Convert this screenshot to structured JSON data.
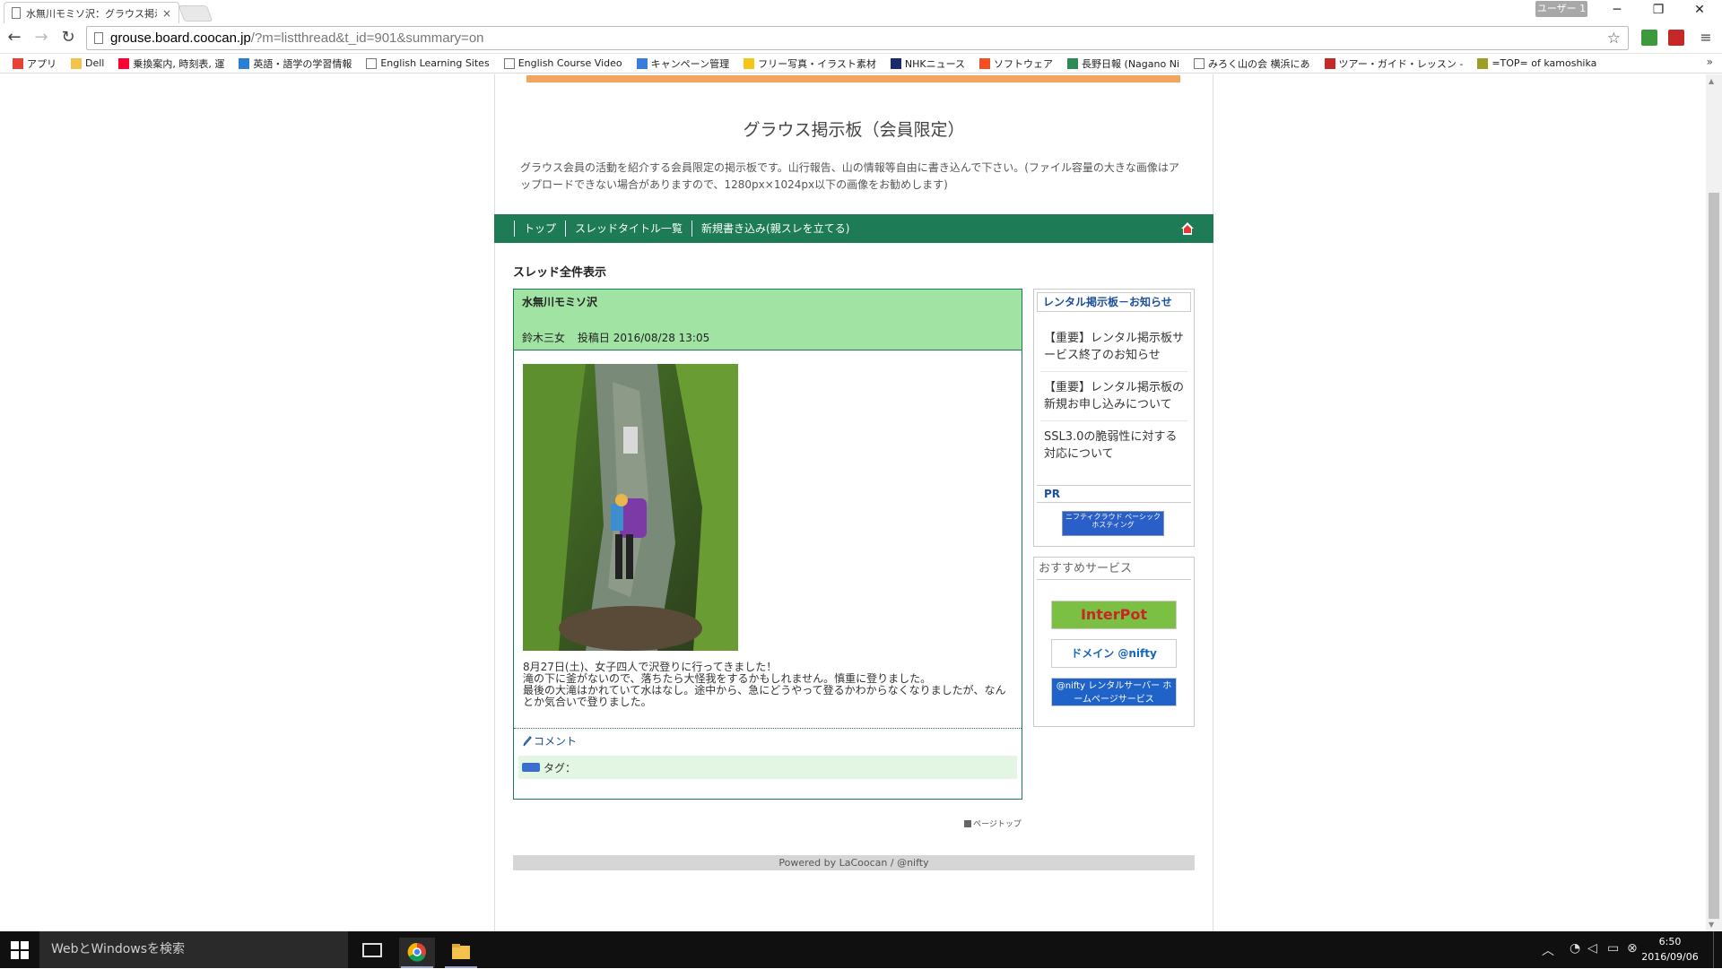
{
  "browser": {
    "tab_title": "水無川モミソ沢：グラウス掲示",
    "tab_close": "×",
    "user_badge": "ユーザー 1",
    "window_controls": {
      "minimize": "─",
      "restore": "❐",
      "close": "✕"
    },
    "nav": {
      "back": "←",
      "forward": "→",
      "reload": "↻"
    },
    "url_domain": "grouse.board.coocan.jp",
    "url_rest": "/?m=listthread&t_id=901&summary=on",
    "star": "☆",
    "menu": "≡",
    "bookmarks": [
      {
        "label": "アプリ",
        "icon": "apps-icon",
        "color": "#e94235"
      },
      {
        "label": "Dell",
        "icon": "folder-icon",
        "color": "#f2c24c"
      },
      {
        "label": "乗換案内, 時刻表, 運",
        "icon": "yahoo-icon",
        "color": "#ff0033"
      },
      {
        "label": "英語・語学の学習情報",
        "icon": "site-icon",
        "color": "#2a7fd4"
      },
      {
        "label": "English Learning Sites",
        "icon": "page-icon",
        "color": "#ffffff"
      },
      {
        "label": "English Course Video",
        "icon": "page-icon",
        "color": "#ffffff"
      },
      {
        "label": "キャンペーン管理",
        "icon": "adwords-icon",
        "color": "#3b7ddd"
      },
      {
        "label": "フリー写真・イラスト素材",
        "icon": "site-icon",
        "color": "#f5c518"
      },
      {
        "label": "NHKニュース",
        "icon": "nhk-icon",
        "color": "#1a2b6b"
      },
      {
        "label": "ソフトウェア",
        "icon": "windows-icon",
        "color": "#f25022"
      },
      {
        "label": "長野日報 (Nagano Ni",
        "icon": "site-icon",
        "color": "#2e8b57"
      },
      {
        "label": "みろく山の会 横浜にあ",
        "icon": "page-icon",
        "color": "#ffffff"
      },
      {
        "label": "ツアー・ガイド・レッスン -",
        "icon": "site-icon",
        "color": "#c62828"
      },
      {
        "label": "=TOP= of kamoshika",
        "icon": "site-icon",
        "color": "#9e9d24"
      }
    ],
    "bookmarks_more": "»"
  },
  "page": {
    "site_title": "グラウス掲示板（会員限定）",
    "site_description": "グラウス会員の活動を紹介する会員限定の掲示板です。山行報告、山の情報等自由に書き込んで下さい。(ファイル容量の大きな画像はアップロードできない場合がありますので、1280px×1024px以下の画像をお勧めします)",
    "nav": {
      "top": "トップ",
      "thread_list": "スレッドタイトル一覧",
      "new_post": "新規書き込み(親スレを立てる)"
    },
    "section_heading": "スレッド全件表示",
    "post": {
      "title": "水無川モミソ沢",
      "author": "鈴木三女",
      "date_label": "投稿日",
      "date": "2016/08/28 13:05",
      "body_line1": "8月27日(土)、女子四人で沢登りに行ってきました！",
      "body_line2": "滝の下に釜がないので、落ちたら大怪我をするかもしれません。慎重に登りました。",
      "body_line3": "最後の大滝はかれていて水はなし。途中から、急にどうやって登るかわからなくなりましたが、なんとか気合いで登りました。",
      "comment_link": "コメント",
      "tag_label": "タグ："
    },
    "page_top": "ページトップ",
    "footer": "Powered by LaCoocan / @nifty",
    "sidebar": {
      "notice_heading": "レンタル掲示板－お知らせ",
      "notices": [
        "【重要】レンタル掲示板サービス終了のお知らせ",
        "【重要】レンタル掲示板の新規お申し込みについて",
        "SSL3.0の脆弱性に対する対応について"
      ],
      "pr_heading": "PR",
      "pr_banner": "ニフティクラウド ベーシックホスティング",
      "recommend_heading": "おすすめサービス",
      "banners": [
        "InterPot",
        "ドメイン @nifty",
        "@nifty レンタルサーバー ホームページサービス"
      ]
    }
  },
  "taskbar": {
    "search_placeholder": "WebとWindowsを検索",
    "time": "6:50",
    "date": "2016/09/06"
  },
  "colors": {
    "accent_green": "#1d7c55",
    "post_header_green": "#a0e3a3",
    "orange_bar": "#f3a45e",
    "link_blue": "#1d4f9b"
  }
}
